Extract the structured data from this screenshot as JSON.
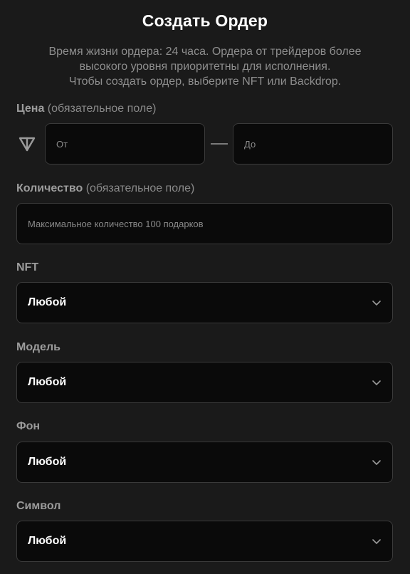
{
  "header": {
    "title": "Создать Ордер",
    "description_lines": [
      "Время жизни ордера: 24 часа. Ордера от трейдеров более",
      "высокого уровня приоритетны для исполнения.",
      "Чтобы создать ордер, выберите NFT или Backdrop."
    ]
  },
  "price": {
    "label": "Цена",
    "required_note": "(обязательное поле)",
    "currency_icon": "ton-icon",
    "from_placeholder": "От",
    "to_placeholder": "До"
  },
  "quantity": {
    "label": "Количество",
    "required_note": "(обязательное поле)",
    "placeholder": "Максимальное количество 100 подарков"
  },
  "selects": [
    {
      "label": "NFT",
      "value": "Любой"
    },
    {
      "label": "Модель",
      "value": "Любой"
    },
    {
      "label": "Фон",
      "value": "Любой"
    },
    {
      "label": "Символ",
      "value": "Любой"
    }
  ],
  "colors": {
    "background": "#1a1a1a",
    "field_background": "#0a0a0a",
    "field_border": "#3a3a3a",
    "muted_text": "#8e8e8e"
  }
}
